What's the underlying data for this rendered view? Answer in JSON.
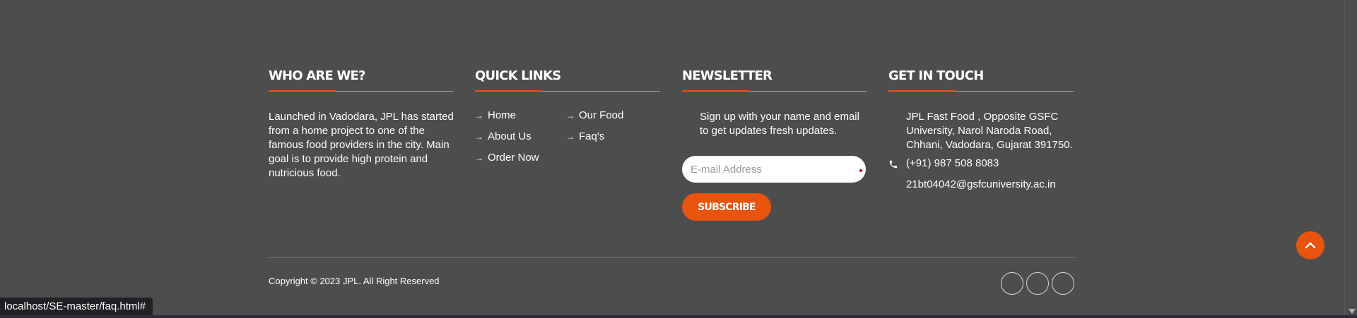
{
  "about": {
    "heading": "WHO ARE WE?",
    "text": "Launched in Vadodara, JPL has started from a home project to one of the famous food providers in the city. Main goal is to provide high protein and nutricious food."
  },
  "quick_links": {
    "heading": "QUICK LINKS",
    "arrow": "→",
    "items": [
      {
        "label": "Home"
      },
      {
        "label": "Our Food"
      },
      {
        "label": "About Us"
      },
      {
        "label": "Faq's"
      },
      {
        "label": "Order Now"
      }
    ]
  },
  "newsletter": {
    "heading": "NEWSLETTER",
    "text": "Sign up with your name and email to get updates fresh updates.",
    "email_placeholder": "E-mail Address",
    "subscribe_label": "SUBSCRIBE"
  },
  "contact": {
    "heading": "GET IN TOUCH",
    "address": "JPL Fast Food , Opposite GSFC University, Narol Naroda Road, Chhani, Vadodara, Gujarat 391750.",
    "phone": "(+91) 987 508 8083",
    "email": "21bt04042@gsfcuniversity.ac.in"
  },
  "bottom": {
    "copyright": "Copyright © 2023 JPL. All Right Reserved",
    "social_count": 3
  },
  "status_bar": {
    "url": "localhost/SE-master/faq.html#"
  },
  "colors": {
    "background": "#4d4d4d",
    "accent": "#e8530e"
  },
  "icons": {
    "phone": "phone-icon",
    "back_to_top": "chevron-up-icon"
  }
}
